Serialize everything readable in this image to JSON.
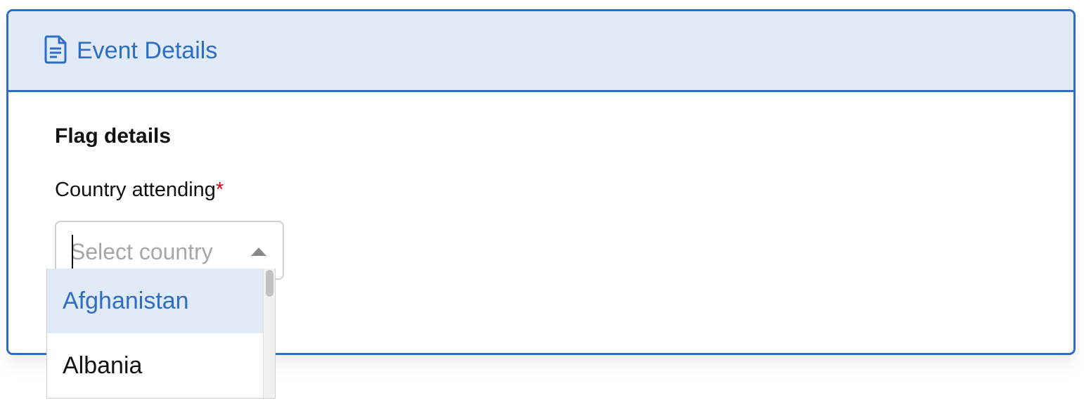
{
  "card": {
    "title": "Event Details",
    "icon": "file-text-icon",
    "accent_color": "#2f6cc2",
    "header_bg": "#e1ebf8"
  },
  "section": {
    "title": "Flag details"
  },
  "country_field": {
    "label": "Country attending",
    "required_mark": "*",
    "placeholder": "Select country",
    "value": "",
    "dropdown_icon": "caret-up-icon"
  },
  "dropdown": {
    "options": [
      {
        "label": "Afghanistan",
        "highlighted": true
      },
      {
        "label": "Albania",
        "highlighted": false
      }
    ]
  }
}
